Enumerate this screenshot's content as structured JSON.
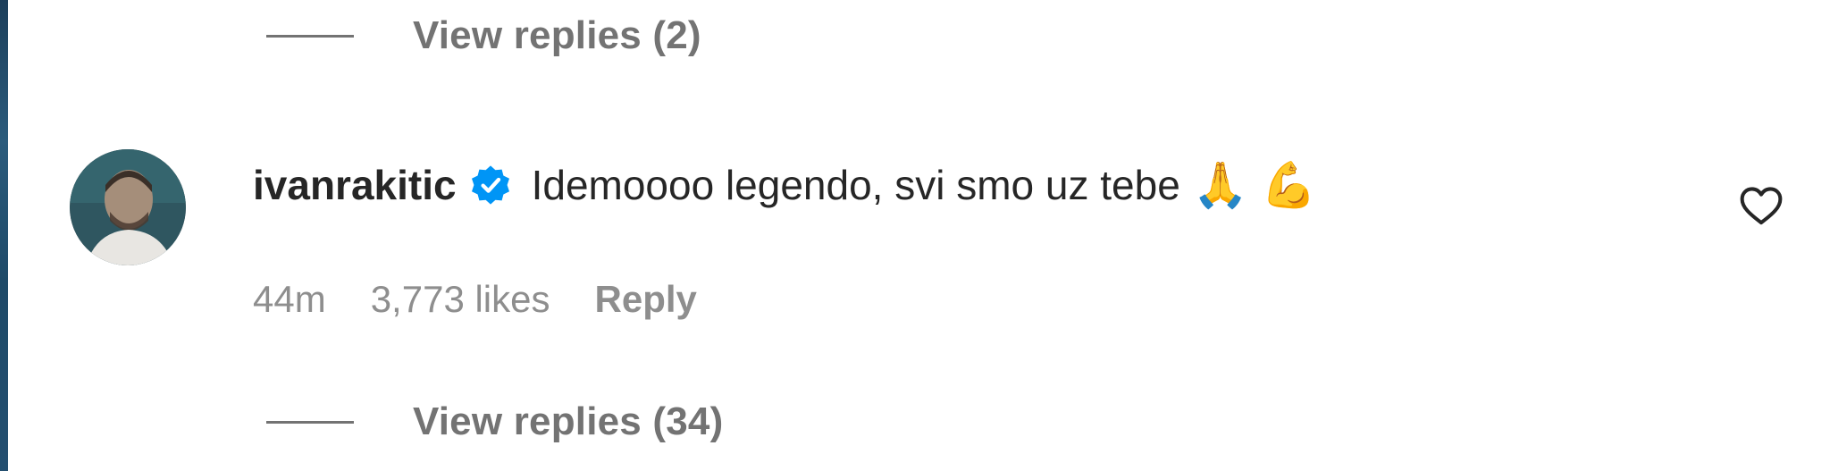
{
  "thread": {
    "replies_top_label": "View replies (2)",
    "replies_bottom_label": "View replies (34)"
  },
  "comment": {
    "username": "ivanrakitic",
    "verified": true,
    "text": "Idemoooo legendo, svi smo uz tebe",
    "emojis": [
      "🙏",
      "💪"
    ],
    "time": "44m",
    "likes": "3,773 likes",
    "reply_label": "Reply"
  },
  "icons": {
    "verified": "verified-badge-icon",
    "like": "heart-outline-icon"
  },
  "colors": {
    "text_primary": "#262626",
    "text_secondary": "#8e8e8e",
    "verified_blue": "#0095f6"
  }
}
